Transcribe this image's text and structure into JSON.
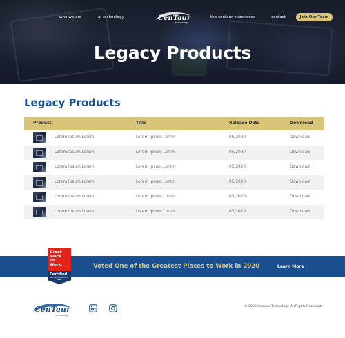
{
  "nav": {
    "who_we_are": "who we are",
    "ai_technology": "ai technology",
    "logo_text": "CenTaur",
    "logo_sub": "technology",
    "centaur_experience": "the centaur experience",
    "contact": "contact",
    "join_button": "Join Our Team"
  },
  "hero": {
    "title": "Legacy Products"
  },
  "main": {
    "title": "Legacy Products"
  },
  "table": {
    "headers": {
      "product": "Product",
      "title": "Title",
      "release_date": "Release Date",
      "download": "Download"
    },
    "rows": [
      {
        "product": "Lorem Ipsum Lorem",
        "title": "Lorem Ipsum Lorem",
        "date": "05/2020",
        "download": "Download"
      },
      {
        "product": "Lorem Ipsum Lorem",
        "title": "Lorem Ipsum Lorem",
        "date": "05/2020",
        "download": "Download"
      },
      {
        "product": "Lorem Ipsum Lorem",
        "title": "Lorem Ipsum Lorem",
        "date": "05/2020",
        "download": "Download"
      },
      {
        "product": "Lorem Ipsum Lorem",
        "title": "Lorem Ipsum Lorem",
        "date": "05/2020",
        "download": "Download"
      },
      {
        "product": "Lorem Ipsum Lorem",
        "title": "Lorem Ipsum Lorem",
        "date": "05/2020",
        "download": "Download"
      },
      {
        "product": "Lorem Ipsum Lorem",
        "title": "Lorem Ipsum Lorem",
        "date": "05/2020",
        "download": "Download"
      }
    ]
  },
  "badge": {
    "line1": "Great",
    "line2": "Place",
    "line3": "To",
    "line4": "Work.",
    "certified": "Certified",
    "dates": "APR 2020-APR 2021",
    "country": "USA"
  },
  "banner": {
    "text": "Voted One of the Greatest Places to Work in 2020",
    "link": "Learn More ›"
  },
  "footer": {
    "logo_text": "CenTaur",
    "logo_sub": "technology",
    "linkedin_icon": "linkedin-icon",
    "instagram_icon": "instagram-icon",
    "copyright": "© 2020 Centaur Technology. All Rights Reserved."
  },
  "colors": {
    "brand_blue": "#1a4f8f",
    "gold": "#d9c57a",
    "badge_red": "#e2231a",
    "badge_navy": "#173a73"
  }
}
